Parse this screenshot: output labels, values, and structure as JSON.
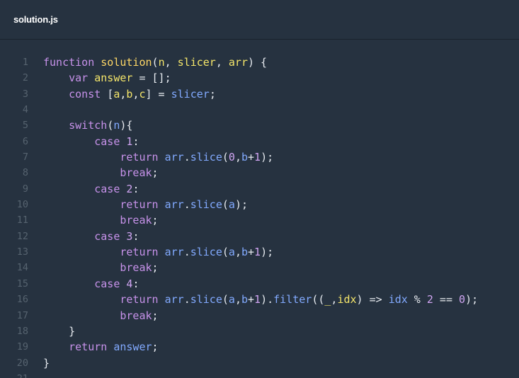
{
  "header": {
    "file_name": "solution.js"
  },
  "code": {
    "lines": [
      {
        "n": "1",
        "tokens": [
          [
            "kw",
            "function "
          ],
          [
            "fn",
            "solution"
          ],
          [
            "pl",
            "("
          ],
          [
            "vr",
            "n"
          ],
          [
            "pl",
            ", "
          ],
          [
            "vr",
            "slicer"
          ],
          [
            "pl",
            ", "
          ],
          [
            "vr",
            "arr"
          ],
          [
            "pl",
            ") {"
          ]
        ]
      },
      {
        "n": "2",
        "tokens": [
          [
            "pl",
            "    "
          ],
          [
            "kw",
            "var "
          ],
          [
            "vr",
            "answer"
          ],
          [
            "pl",
            " = [];"
          ]
        ]
      },
      {
        "n": "3",
        "tokens": [
          [
            "pl",
            "    "
          ],
          [
            "kw",
            "const "
          ],
          [
            "pl",
            "["
          ],
          [
            "vr",
            "a"
          ],
          [
            "pl",
            ","
          ],
          [
            "vr",
            "b"
          ],
          [
            "pl",
            ","
          ],
          [
            "vr",
            "c"
          ],
          [
            "pl",
            "] = "
          ],
          [
            "id",
            "slicer"
          ],
          [
            "pl",
            ";"
          ]
        ]
      },
      {
        "n": "4",
        "tokens": []
      },
      {
        "n": "5",
        "tokens": [
          [
            "pl",
            "    "
          ],
          [
            "kw",
            "switch"
          ],
          [
            "pl",
            "("
          ],
          [
            "id",
            "n"
          ],
          [
            "pl",
            "){"
          ]
        ]
      },
      {
        "n": "6",
        "tokens": [
          [
            "pl",
            "        "
          ],
          [
            "kw",
            "case "
          ],
          [
            "nm2",
            "1"
          ],
          [
            "pl",
            ":"
          ]
        ]
      },
      {
        "n": "7",
        "tokens": [
          [
            "pl",
            "            "
          ],
          [
            "kw",
            "return "
          ],
          [
            "id",
            "arr"
          ],
          [
            "pl",
            "."
          ],
          [
            "id",
            "slice"
          ],
          [
            "pl",
            "("
          ],
          [
            "nm2",
            "0"
          ],
          [
            "pl",
            ","
          ],
          [
            "id",
            "b"
          ],
          [
            "pl",
            "+"
          ],
          [
            "nm2",
            "1"
          ],
          [
            "pl",
            ");"
          ]
        ]
      },
      {
        "n": "8",
        "tokens": [
          [
            "pl",
            "            "
          ],
          [
            "kw",
            "break"
          ],
          [
            "pl",
            ";"
          ]
        ]
      },
      {
        "n": "9",
        "tokens": [
          [
            "pl",
            "        "
          ],
          [
            "kw",
            "case "
          ],
          [
            "nm2",
            "2"
          ],
          [
            "pl",
            ":"
          ]
        ]
      },
      {
        "n": "10",
        "tokens": [
          [
            "pl",
            "            "
          ],
          [
            "kw",
            "return "
          ],
          [
            "id",
            "arr"
          ],
          [
            "pl",
            "."
          ],
          [
            "id",
            "slice"
          ],
          [
            "pl",
            "("
          ],
          [
            "id",
            "a"
          ],
          [
            "pl",
            ");"
          ]
        ]
      },
      {
        "n": "11",
        "tokens": [
          [
            "pl",
            "            "
          ],
          [
            "kw",
            "break"
          ],
          [
            "pl",
            ";"
          ]
        ]
      },
      {
        "n": "12",
        "tokens": [
          [
            "pl",
            "        "
          ],
          [
            "kw",
            "case "
          ],
          [
            "nm2",
            "3"
          ],
          [
            "pl",
            ":"
          ]
        ]
      },
      {
        "n": "13",
        "tokens": [
          [
            "pl",
            "            "
          ],
          [
            "kw",
            "return "
          ],
          [
            "id",
            "arr"
          ],
          [
            "pl",
            "."
          ],
          [
            "id",
            "slice"
          ],
          [
            "pl",
            "("
          ],
          [
            "id",
            "a"
          ],
          [
            "pl",
            ","
          ],
          [
            "id",
            "b"
          ],
          [
            "pl",
            "+"
          ],
          [
            "nm2",
            "1"
          ],
          [
            "pl",
            ");"
          ]
        ]
      },
      {
        "n": "14",
        "tokens": [
          [
            "pl",
            "            "
          ],
          [
            "kw",
            "break"
          ],
          [
            "pl",
            ";"
          ]
        ]
      },
      {
        "n": "15",
        "tokens": [
          [
            "pl",
            "        "
          ],
          [
            "kw",
            "case "
          ],
          [
            "nm2",
            "4"
          ],
          [
            "pl",
            ":"
          ]
        ]
      },
      {
        "n": "16",
        "tokens": [
          [
            "pl",
            "            "
          ],
          [
            "kw",
            "return "
          ],
          [
            "id",
            "arr"
          ],
          [
            "pl",
            "."
          ],
          [
            "id",
            "slice"
          ],
          [
            "pl",
            "("
          ],
          [
            "id",
            "a"
          ],
          [
            "pl",
            ","
          ],
          [
            "id",
            "b"
          ],
          [
            "pl",
            "+"
          ],
          [
            "nm2",
            "1"
          ],
          [
            "pl",
            ")."
          ],
          [
            "id",
            "filter"
          ],
          [
            "pl",
            "(("
          ],
          [
            "vr",
            "_"
          ],
          [
            "pl",
            ","
          ],
          [
            "vr",
            "idx"
          ],
          [
            "pl",
            ") => "
          ],
          [
            "id",
            "idx"
          ],
          [
            "pl",
            " % "
          ],
          [
            "nm2",
            "2"
          ],
          [
            "pl",
            " == "
          ],
          [
            "nm2",
            "0"
          ],
          [
            "pl",
            ");"
          ]
        ]
      },
      {
        "n": "17",
        "tokens": [
          [
            "pl",
            "            "
          ],
          [
            "kw",
            "break"
          ],
          [
            "pl",
            ";"
          ]
        ]
      },
      {
        "n": "18",
        "tokens": [
          [
            "pl",
            "    }"
          ]
        ]
      },
      {
        "n": "19",
        "tokens": [
          [
            "pl",
            "    "
          ],
          [
            "kw",
            "return "
          ],
          [
            "id",
            "answer"
          ],
          [
            "pl",
            ";"
          ]
        ]
      },
      {
        "n": "20",
        "tokens": [
          [
            "pl",
            "}"
          ]
        ]
      },
      {
        "n": "21",
        "tokens": []
      }
    ]
  },
  "colors": {
    "background": "#263240",
    "keyword": "#c792ea",
    "function": "#ffd866",
    "identifier": "#82aaff",
    "number": "#d0a5f2",
    "line_number": "#56636f"
  }
}
